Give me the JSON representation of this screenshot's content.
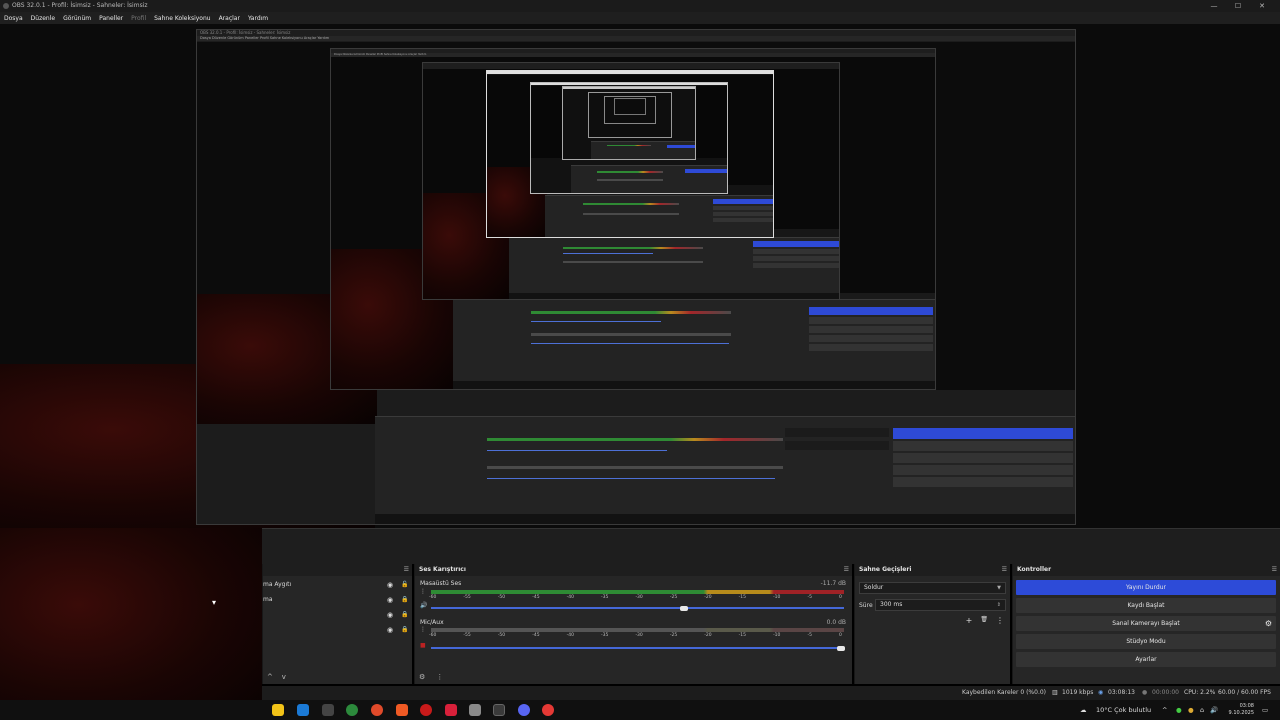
{
  "window": {
    "title": "OBS 32.0.1 - Profil: İsimsiz - Sahneler: İsimsiz",
    "controls": [
      "—",
      "☐",
      "✕"
    ]
  },
  "menu": [
    "Dosya",
    "Düzenle",
    "Görünüm",
    "Paneller",
    "Profil",
    "Sahne Koleksiyonu",
    "Araçlar",
    "Yardım"
  ],
  "sources_dock": {
    "items": [
      {
        "label": "ma Aygıtı"
      },
      {
        "label": "ma"
      },
      {
        "label": ""
      },
      {
        "label": ""
      }
    ],
    "toolbar": [
      "^",
      "v"
    ]
  },
  "mixer": {
    "title": "Ses Karıştırıcı",
    "ticks": [
      "-60",
      "-55",
      "-50",
      "-45",
      "-40",
      "-35",
      "-30",
      "-25",
      "-20",
      "-15",
      "-10",
      "-5",
      "0"
    ],
    "channels": [
      {
        "name": "Masaüstü Ses",
        "db": "-11.7 dB",
        "level": 0.66,
        "volume": 0.62
      },
      {
        "name": "Mic/Aux",
        "db": "0.0 dB",
        "level": 0.0,
        "volume": 1.0
      }
    ],
    "toolbar": [
      "⚙",
      "⋮"
    ]
  },
  "transitions": {
    "title": "Sahne Geçişleri",
    "selected": "Soldur",
    "duration_label": "Süre",
    "duration_value": "300 ms",
    "toolbar": [
      "+",
      "🗑",
      "⋮"
    ]
  },
  "controls": {
    "title": "Kontroller",
    "buttons": [
      "Yayını Durdur",
      "Kaydı Başlat",
      "Sanal Kamerayı Başlat",
      "Stüdyo Modu",
      "Ayarlar"
    ]
  },
  "status": {
    "dropped": "Kaybedilen Kareler 0 (%0.0)",
    "bitrate": "1019 kbps",
    "live_time": "03:08:13",
    "rec_time": "00:00:00",
    "cpu": "CPU: 2.2%",
    "fps": "60.00 / 60.00 FPS"
  },
  "taskbar": {
    "weather": "10°C  Çok bulutlu",
    "time": "03:08",
    "date": "9.10.2025"
  },
  "colors": {
    "accent": "#2d4bd8",
    "meter_green": "#2e8b34",
    "meter_yellow": "#b68b1b",
    "meter_red": "#a02226"
  }
}
